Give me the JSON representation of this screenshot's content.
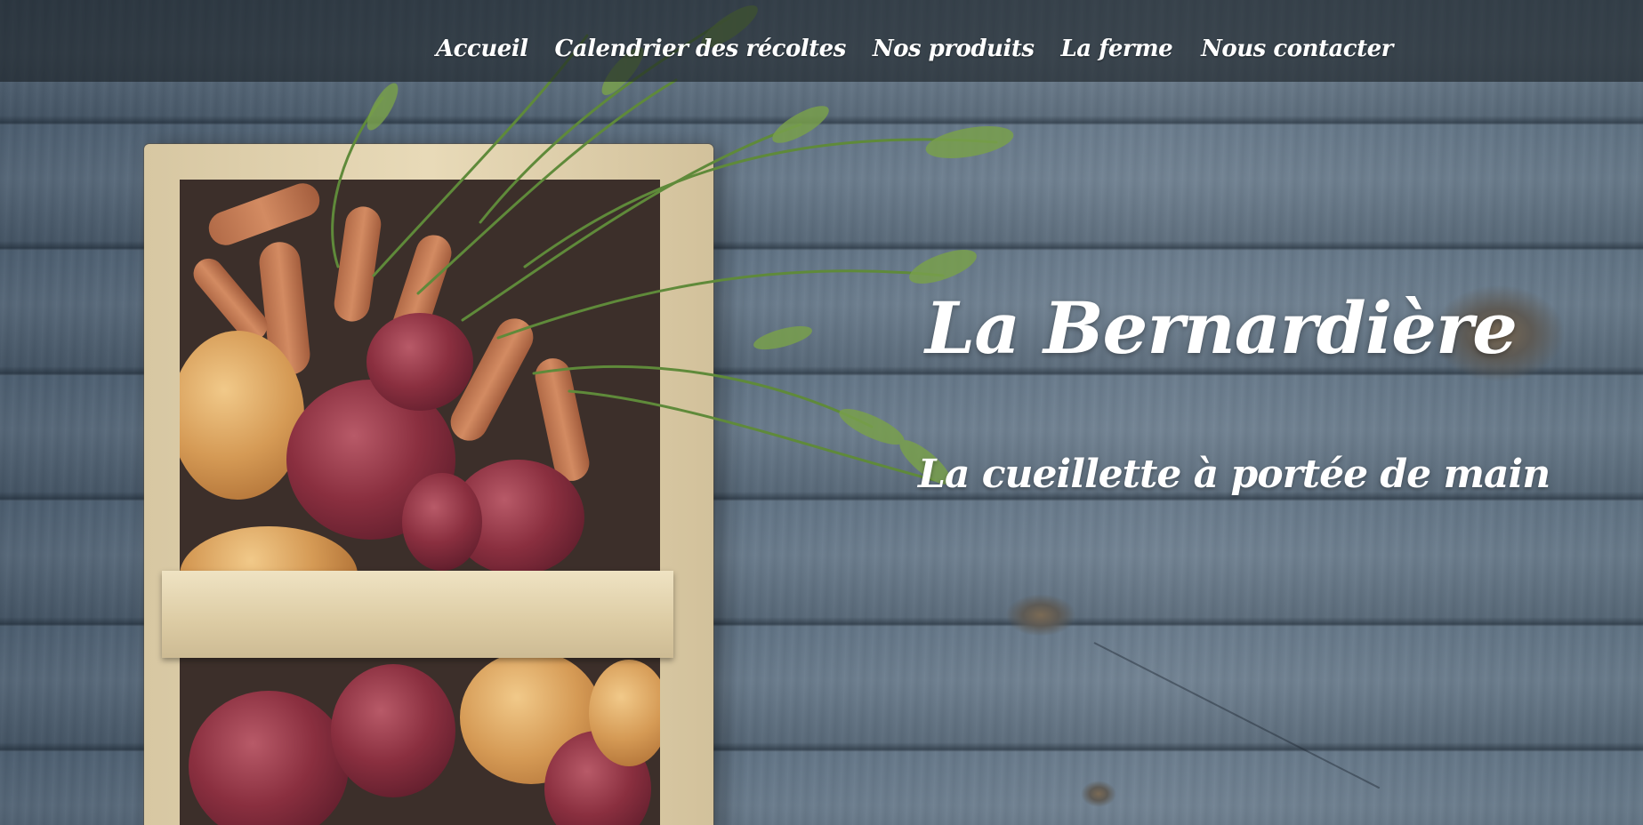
{
  "nav": {
    "items": [
      {
        "label": "Accueil"
      },
      {
        "label": "Calendrier des récoltes"
      },
      {
        "label": "Nos produits"
      },
      {
        "label": "La ferme"
      },
      {
        "label": "Nous contacter"
      }
    ]
  },
  "hero": {
    "title": "La Bernardière",
    "tagline": "La cueillette à portée de main",
    "image": "vegetable-basket-on-wooden-table"
  },
  "colors": {
    "text": "#ffffff",
    "navbar_overlay": "#181e24",
    "wood_blue_gray": "#5d7082"
  }
}
